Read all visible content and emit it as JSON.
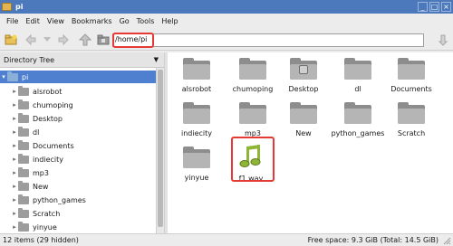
{
  "window": {
    "title": "pi",
    "min": "_",
    "max": "□",
    "close": "×"
  },
  "menu": [
    "File",
    "Edit",
    "View",
    "Bookmarks",
    "Go",
    "Tools",
    "Help"
  ],
  "path": "/home/pi",
  "sidebar": {
    "header": "Directory Tree",
    "root": "pi",
    "items": [
      "alsrobot",
      "chumoping",
      "Desktop",
      "dl",
      "Documents",
      "indiecity",
      "mp3",
      "New",
      "python_games",
      "Scratch",
      "yinyue"
    ]
  },
  "files": [
    {
      "name": "alsrobot",
      "type": "folder"
    },
    {
      "name": "chumoping",
      "type": "folder"
    },
    {
      "name": "Desktop",
      "type": "folder-desktop"
    },
    {
      "name": "dl",
      "type": "folder"
    },
    {
      "name": "Documents",
      "type": "folder"
    },
    {
      "name": "indiecity",
      "type": "folder"
    },
    {
      "name": "mp3",
      "type": "folder"
    },
    {
      "name": "New",
      "type": "folder"
    },
    {
      "name": "python_games",
      "type": "folder"
    },
    {
      "name": "Scratch",
      "type": "folder"
    },
    {
      "name": "yinyue",
      "type": "folder"
    },
    {
      "name": "f1.wav",
      "type": "audio"
    }
  ],
  "status": {
    "left": "12 items (29 hidden)",
    "right": "Free space: 9.3 GiB (Total: 14.5 GiB)"
  },
  "colors": {
    "titlebar": "#4c79bb",
    "selection": "#4f7fcf",
    "highlight": "#e53935",
    "music": "#8fb536"
  }
}
